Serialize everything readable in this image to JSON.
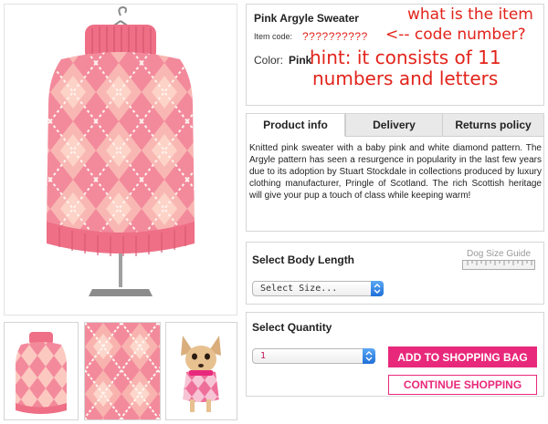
{
  "product": {
    "title": "Pink Argyle Sweater",
    "code_label": "Item code:",
    "code_value": "??????????",
    "color_label": "Color:",
    "color_value": "Pink"
  },
  "annotations": {
    "line1": "what is the item",
    "line2": "<-- code number?",
    "line3": "hint: it consists of 11",
    "line4": "numbers and letters"
  },
  "tabs": {
    "items": [
      {
        "label": "Product info",
        "active": true
      },
      {
        "label": "Delivery",
        "active": false
      },
      {
        "label": "Returns policy",
        "active": false
      }
    ],
    "product_info_text": "Knitted pink sweater with a baby pink and white diamond pattern. The Argyle pattern has seen a resurgence in popularity in the last few years due to its adoption by Stuart Stockdale in collections produced by luxury clothing manufacturer, Pringle of Scotland. The rich Scottish heritage will give your pup a touch of class while keeping warm!"
  },
  "body_length": {
    "title": "Select Body Length",
    "size_guide_label": "Dog Size Guide",
    "select_value": "Select Size..."
  },
  "quantity": {
    "title": "Select Quantity",
    "select_value": "1",
    "add_button": "ADD TO SHOPPING BAG",
    "continue_button": "CONTINUE SHOPPING"
  },
  "colors": {
    "accent": "#e8297b",
    "annotation": "#e2231a",
    "sweater": "#f07f95",
    "diamond": "#fbc8bf",
    "select_button": "#2f80e0"
  },
  "icons": {
    "select_arrow": "updown-chevron-icon",
    "ruler": "ruler-icon"
  }
}
